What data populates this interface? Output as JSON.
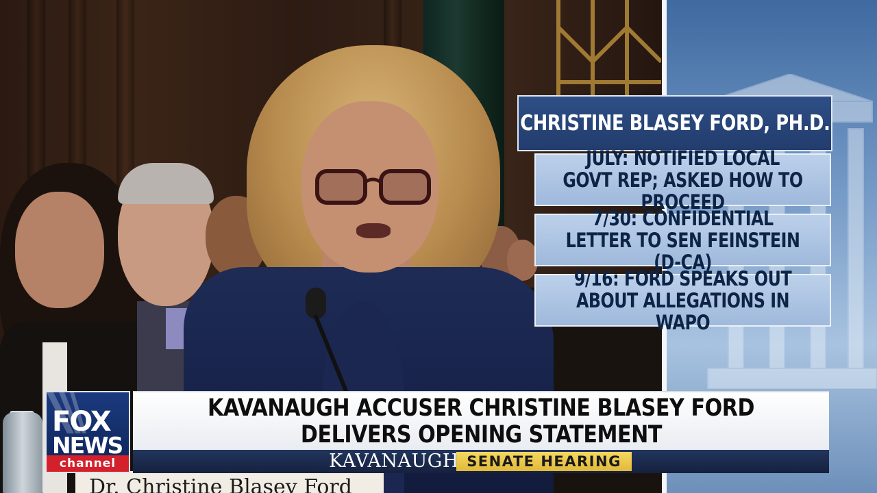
{
  "fullscreen_graphic": {
    "name_title": "CHRISTINE BLASEY FORD, PH.D.",
    "facts": [
      "JULY: NOTIFIED LOCAL GOVT REP; ASKED HOW TO PROCEED",
      "7/30: CONFIDENTIAL LETTER TO SEN FEINSTEIN (D-CA)",
      "9/16: FORD SPEAKS OUT ABOUT ALLEGATIONS IN WAPO"
    ]
  },
  "lower_third": {
    "headline_line1": "KAVANAUGH ACCUSER CHRISTINE BLASEY FORD",
    "headline_line2": "DELIVERS OPENING STATEMENT",
    "show_name": "KAVANAUGH",
    "segment_tag": "SENATE HEARING"
  },
  "network_logo": {
    "line1": "FOX",
    "line2": "NEWS",
    "line3": "channel"
  },
  "scene": {
    "nameplate_text": "Dr. Christine Blasey Ford"
  },
  "colors": {
    "graphic_navy": "#223c6d",
    "fact_box": "#b0c6e4",
    "strap_navy": "#15213e",
    "segment_gold": "#e8c84a",
    "logo_red": "#d4202b"
  }
}
